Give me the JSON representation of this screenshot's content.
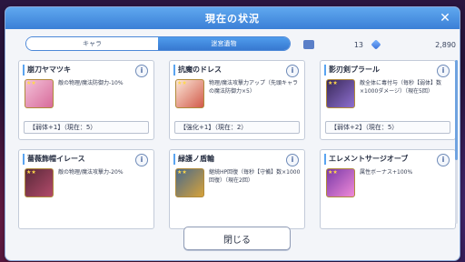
{
  "dialog": {
    "title": "現在の状況",
    "close_label": "閉じる"
  },
  "tabs": [
    {
      "label": "キャラ",
      "active": false
    },
    {
      "label": "迷宮遺物",
      "active": true
    }
  ],
  "counters": {
    "ticket_count": "13",
    "crystal_count": "2,890"
  },
  "relics": [
    {
      "name": "崩刀ヤマツキ",
      "description": "敵の物理/魔法防御力-10%",
      "status": "【弱体+1】（現在：5）",
      "icon_color": "#d86b9a",
      "icon": "sword-icon"
    },
    {
      "name": "抗魔のドレス",
      "description": "物理/魔法攻撃力アップ（先頭キャラの魔法防御力×5）",
      "status": "【強化+1】（現在：2）",
      "icon_color": "#e3b6a0",
      "icon": "dress-icon"
    },
    {
      "name": "影刃剣プラール",
      "description": "敵全体に毒付与（毎秒【弱体】数×1000ダメージ）（現在5回）",
      "status": "【弱体+2】（現在：5）",
      "icon_color": "#8e6fd0",
      "icon": "blade-icon"
    },
    {
      "name": "薔薇飾帽イレース",
      "description": "敵の物理/魔法攻撃力-20%",
      "status": "",
      "icon_color": "#b24a6a",
      "icon": "hat-icon"
    },
    {
      "name": "緑護ノ盾輪",
      "description": "継続HP回復（毎秒【守備】数×1000回復）（現在2回）",
      "status": "",
      "icon_color": "#d6a23a",
      "icon": "shield-ring-icon"
    },
    {
      "name": "エレメントサージオーブ",
      "description": "属性ボーナス+100%",
      "status": "",
      "icon_color": "#c16ed8",
      "icon": "orb-icon"
    }
  ],
  "info_glyph": "i"
}
